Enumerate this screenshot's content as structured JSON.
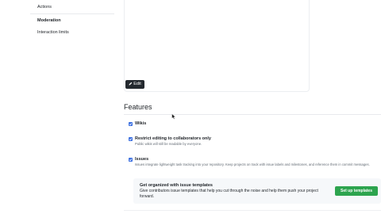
{
  "sidebar": {
    "actions_label": "Actions",
    "moderation_heading": "Moderation",
    "interaction_limits_label": "Interaction limits"
  },
  "preview": {
    "edit_label": "Edit"
  },
  "features": {
    "title": "Features",
    "options": [
      {
        "label": "Wikis",
        "checked": true,
        "description": ""
      },
      {
        "label": "Restrict editing to collaborators only",
        "checked": true,
        "description": "Public wikis will still be readable by everyone."
      },
      {
        "label": "Issues",
        "checked": true,
        "description": "Issues integrate lightweight task tracking into your repository. Keep projects on track with issue labels and milestones, and reference them in commit messages."
      }
    ],
    "templates": {
      "title": "Get organized with issue templates",
      "description": "Give contributors issue templates that help you cut through the noise and help them push your project forward.",
      "button_label": "Set up templates"
    }
  },
  "colors": {
    "checkbox": "#3b6fe0",
    "primary_button": "#2da44e",
    "dark_button": "#24292f"
  }
}
